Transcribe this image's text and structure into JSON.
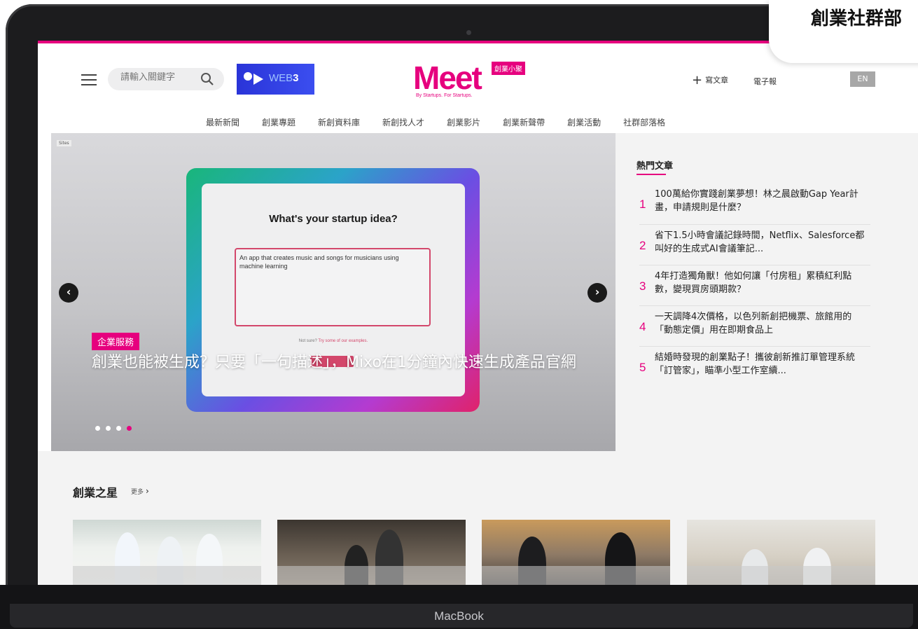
{
  "bubble": {
    "text": "創業社群部"
  },
  "device": {
    "brand_label": "MacBook"
  },
  "header": {
    "search_placeholder": "請輸入關鍵字",
    "web3_label_prefix": "WEB",
    "web3_label_suffix": "3",
    "logo_text": "Meet",
    "logo_tag": "創業小聚",
    "logo_sub": "By Startups. For Startups.",
    "write_article": "寫文章",
    "ebook": "電子報",
    "lang": "EN"
  },
  "nav": {
    "items": [
      "最新新聞",
      "創業專題",
      "新創資料庫",
      "新創找人才",
      "創業影片",
      "創業新聲帶",
      "創業活動",
      "社群部落格"
    ]
  },
  "hero": {
    "site_tag": "Sites",
    "card_title": "What's your startup idea?",
    "card_input_text": "An app that creates music and songs for musicians using machine learning",
    "card_hint_prefix": "Not sure?",
    "card_hint_link": "Try some of our examples.",
    "category": "企業服務",
    "title": "創業也能被生成？只要「一句描述」，Mixo在1分鐘內快速生成產品官網",
    "slide_count": 4,
    "active_slide": 4
  },
  "sidebar": {
    "title": "熱門文章",
    "items": [
      {
        "num": "1",
        "text": "100萬給你實踐創業夢想！林之晨啟動Gap Year計畫，申請規則是什麼？"
      },
      {
        "num": "2",
        "text": "省下1.5小時會議記錄時間，Netflix、Salesforce都叫好的生成式AI會議筆記..."
      },
      {
        "num": "3",
        "text": "4年打造獨角獸！他如何讓「付房租」累積紅利點數，變現買房頭期款？"
      },
      {
        "num": "4",
        "text": "一天調降4次價格，以色列新創把機票、旅館用的「動態定價」用在即期食品上"
      },
      {
        "num": "5",
        "text": "結婚時發現的創業點子！攜彼創新推訂單管理系統「訂管家」，瞄準小型工作室續..."
      }
    ]
  },
  "stars": {
    "title": "創業之星",
    "more": "更多"
  },
  "colors": {
    "brand_pink": "#e6007e",
    "web3_blue": "#2a34d8"
  }
}
